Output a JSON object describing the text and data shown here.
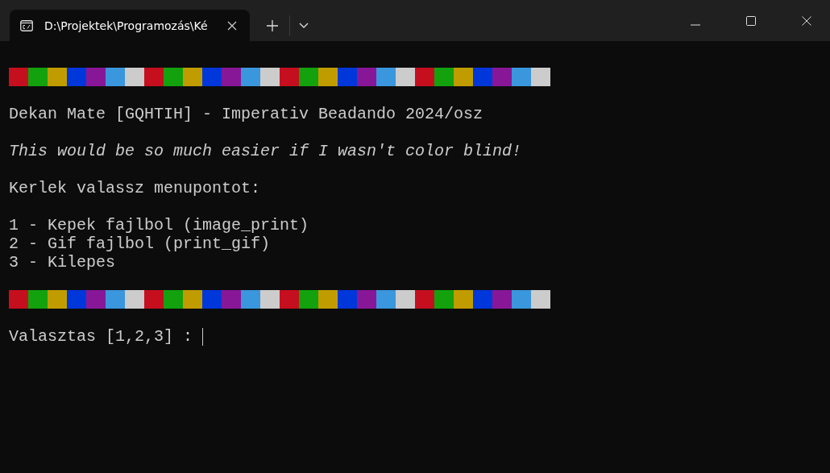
{
  "tabs": [
    {
      "title": "D:\\Projektek\\Programozás\\Ké",
      "selected": true
    }
  ],
  "console": {
    "lines": [
      {
        "kind": "blank"
      },
      {
        "kind": "color_bar",
        "blocks": [
          {
            "color": "#c50f1f"
          },
          {
            "color": "#13a10e"
          },
          {
            "color": "#c19c00"
          },
          {
            "color": "#0037da"
          },
          {
            "color": "#881798"
          },
          {
            "color": "#3a96dd"
          },
          {
            "color": "#cccccc"
          },
          {
            "color": "#c50f1f"
          },
          {
            "color": "#13a10e"
          },
          {
            "color": "#c19c00"
          },
          {
            "color": "#0037da"
          },
          {
            "color": "#881798"
          },
          {
            "color": "#3a96dd"
          },
          {
            "color": "#cccccc"
          },
          {
            "color": "#c50f1f"
          },
          {
            "color": "#13a10e"
          },
          {
            "color": "#c19c00"
          },
          {
            "color": "#0037da"
          },
          {
            "color": "#881798"
          },
          {
            "color": "#3a96dd"
          },
          {
            "color": "#cccccc"
          },
          {
            "color": "#c50f1f"
          },
          {
            "color": "#13a10e"
          },
          {
            "color": "#c19c00"
          },
          {
            "color": "#0037da"
          },
          {
            "color": "#881798"
          },
          {
            "color": "#3a96dd"
          },
          {
            "color": "#cccccc"
          }
        ]
      },
      {
        "kind": "blank"
      },
      {
        "kind": "text",
        "text": "Dekan Mate [GQHTIH] - Imperativ Beadando 2024/osz"
      },
      {
        "kind": "blank"
      },
      {
        "kind": "italic",
        "text": "This would be so much easier if I wasn't color blind!"
      },
      {
        "kind": "blank"
      },
      {
        "kind": "text",
        "text": "Kerlek valassz menupontot:"
      },
      {
        "kind": "blank"
      },
      {
        "kind": "text",
        "text": "1 - Kepek fajlbol (image_print)"
      },
      {
        "kind": "text",
        "text": "2 - Gif fajlbol (print_gif)"
      },
      {
        "kind": "text",
        "text": "3 - Kilepes"
      },
      {
        "kind": "blank"
      },
      {
        "kind": "color_bar",
        "blocks": [
          {
            "color": "#c50f1f"
          },
          {
            "color": "#13a10e"
          },
          {
            "color": "#c19c00"
          },
          {
            "color": "#0037da"
          },
          {
            "color": "#881798"
          },
          {
            "color": "#3a96dd"
          },
          {
            "color": "#cccccc"
          },
          {
            "color": "#c50f1f"
          },
          {
            "color": "#13a10e"
          },
          {
            "color": "#c19c00"
          },
          {
            "color": "#0037da"
          },
          {
            "color": "#881798"
          },
          {
            "color": "#3a96dd"
          },
          {
            "color": "#cccccc"
          },
          {
            "color": "#c50f1f"
          },
          {
            "color": "#13a10e"
          },
          {
            "color": "#c19c00"
          },
          {
            "color": "#0037da"
          },
          {
            "color": "#881798"
          },
          {
            "color": "#3a96dd"
          },
          {
            "color": "#cccccc"
          },
          {
            "color": "#c50f1f"
          },
          {
            "color": "#13a10e"
          },
          {
            "color": "#c19c00"
          },
          {
            "color": "#0037da"
          },
          {
            "color": "#881798"
          },
          {
            "color": "#3a96dd"
          },
          {
            "color": "#cccccc"
          }
        ]
      },
      {
        "kind": "blank"
      },
      {
        "kind": "prompt",
        "text": "Valasztas [1,2,3] :",
        "cursor": true
      }
    ]
  }
}
